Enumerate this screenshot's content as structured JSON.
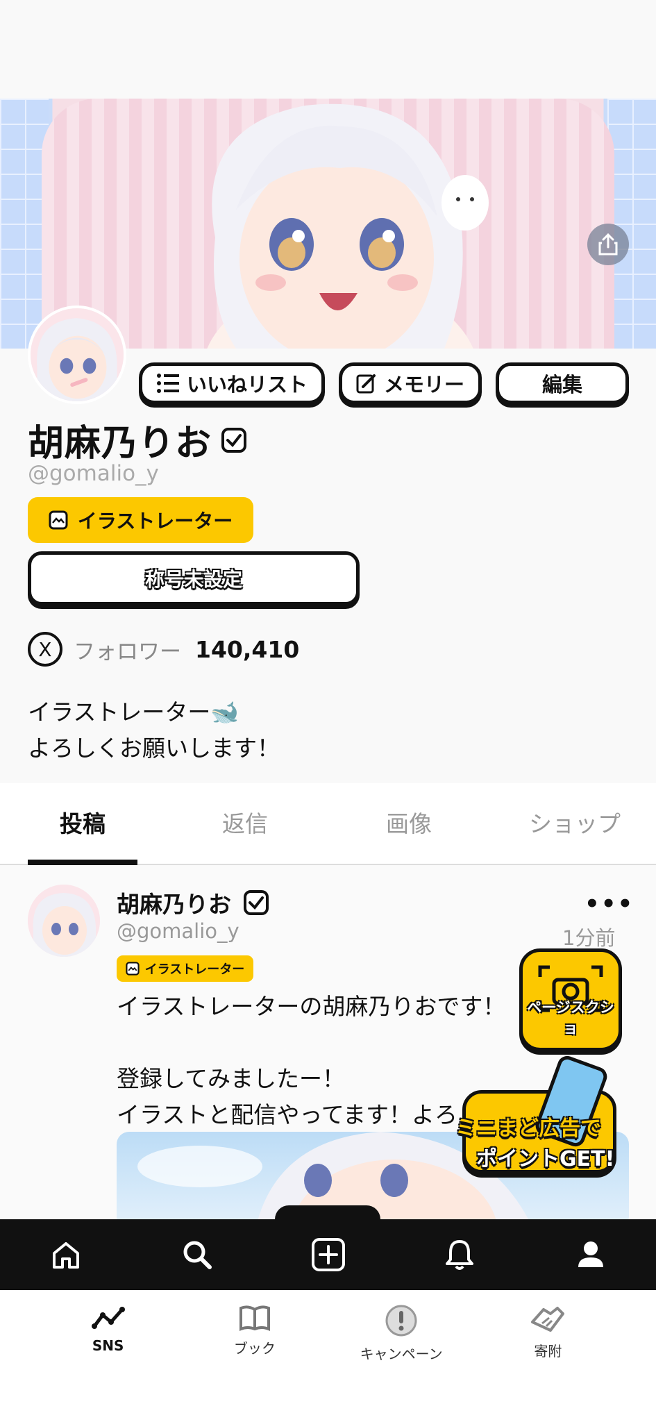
{
  "profile": {
    "name": "胡麻乃りお",
    "handle": "@gomalio_y",
    "role_badge": "イラストレーター",
    "title_label": "称号未設定",
    "follower_label": "フォロワー",
    "follower_count": "140,410",
    "x_icon_text": "X",
    "bio_line1": "イラストレーター🐋",
    "bio_line2": "よろしくお願いします！"
  },
  "actions": {
    "likes_list": "いいねリスト",
    "memory": "メモリー",
    "edit": "編集"
  },
  "tabs": [
    {
      "label": "投稿",
      "active": true
    },
    {
      "label": "返信",
      "active": false
    },
    {
      "label": "画像",
      "active": false
    },
    {
      "label": "ショップ",
      "active": false
    }
  ],
  "post": {
    "author": "胡麻乃りお",
    "handle": "@gomalio_y",
    "time": "1分前",
    "badge": "イラストレーター",
    "more": "•••",
    "text": "イラストレーターの胡麻乃りおです！\n\n登録してみましたー！\nイラストと配信やってます！よろし"
  },
  "floating": {
    "screenshot_label": "ページスクショ",
    "ad_line1": "ミニまど広告で",
    "ad_line2": "ポイントGET!"
  },
  "bottom_nav": [
    {
      "label": "SNS",
      "icon": "sns-icon",
      "active": true
    },
    {
      "label": "ブック",
      "icon": "book-icon",
      "active": false
    },
    {
      "label": "キャンペーン",
      "icon": "campaign-icon",
      "active": false
    },
    {
      "label": "寄附",
      "icon": "donation-icon",
      "active": false
    }
  ],
  "colors": {
    "accent_yellow": "#fcc800",
    "dark": "#111111"
  }
}
